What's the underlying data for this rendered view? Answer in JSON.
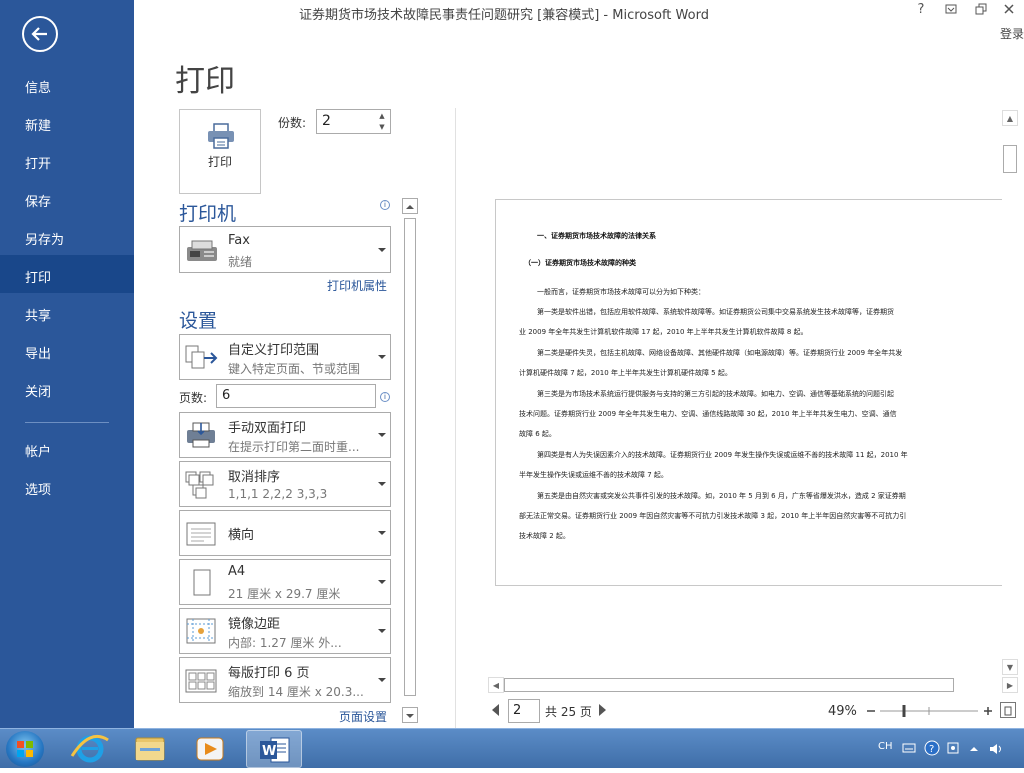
{
  "window": {
    "title": "证券期货市场技术故障民事责任问题研究 [兼容模式] - Microsoft Word",
    "help": "?",
    "login": "登录"
  },
  "sidebar": {
    "items": [
      {
        "label": "信息"
      },
      {
        "label": "新建"
      },
      {
        "label": "打开"
      },
      {
        "label": "保存"
      },
      {
        "label": "另存为"
      },
      {
        "label": "打印",
        "active": true
      },
      {
        "label": "共享"
      },
      {
        "label": "导出"
      },
      {
        "label": "关闭"
      }
    ],
    "bottom": [
      {
        "label": "帐户"
      },
      {
        "label": "选项"
      }
    ],
    "bg_color": "#2b579a",
    "active_color": "#19478a"
  },
  "print": {
    "heading": "打印",
    "print_button": "打印",
    "copies_label": "份数:",
    "copies_value": "2",
    "printer_section": "打印机",
    "printer": {
      "name": "Fax",
      "status": "就绪"
    },
    "printer_properties": "打印机属性",
    "settings_section": "设置",
    "range": {
      "title": "自定义打印范围",
      "sub": "键入特定页面、节或范围"
    },
    "pages_label": "页数:",
    "pages_value": "6",
    "duplex": {
      "title": "手动双面打印",
      "sub": "在提示打印第二面时重..."
    },
    "collate": {
      "title": "取消排序",
      "sub": "1,1,1    2,2,2    3,3,3"
    },
    "orientation": {
      "title": "横向"
    },
    "paper": {
      "title": "A4",
      "sub": "21 厘米 x 29.7 厘米"
    },
    "margins": {
      "title": "镜像边距",
      "sub": "内部:  1.27 厘米     外..."
    },
    "per_sheet": {
      "title": "每版打印 6 页",
      "sub": "缩放到 14 厘米 x 20.3..."
    },
    "page_setup": "页面设置"
  },
  "preview": {
    "current_page": "2",
    "total_pages": "共 25 页",
    "zoom": "49%",
    "zoom_fraction": 0.49,
    "document": {
      "heading1": "一、证券期货市场技术故障的法律关系",
      "heading2": "（一）证券期货市场技术故障的种类",
      "lines": [
        "一般而言，证券期货市场技术故障可以分为如下种类：",
        "第一类是软件出错，包括应用软件故障、系统软件故障等。如证券期货公司集中交易系统发生技术故障等，证券期货",
        "业 2009 年全年共发生计算机软件故障 17 起，2010 年上半年共发生计算机软件故障 8 起。",
        "第二类是硬件失灵，包括主机故障、网络设备故障、其他硬件故障（如电源故障）等。证券期货行业 2009 年全年共发",
        "计算机硬件故障 7 起，2010 年上半年共发生计算机硬件故障 5 起。",
        "第三类是为市场技术系统运行提供服务与支持的第三方引起的技术故障。如电力、空调、通信等基础系统的问题引起",
        "技术问题。证券期货行业 2009 年全年共发生电力、空调、通信线路故障 30 起，2010 年上半年共发生电力、空调、通信",
        "故障 6 起。",
        "第四类是有人为失误因素介入的技术故障。证券期货行业 2009 年发生操作失误或运维不善的技术故障 11 起，2010 年",
        "半年发生操作失误或运维不善的技术故障 7 起。",
        "第五类是由自然灾害或突发公共事件引发的技术故障。如，2010 年 5 月到 6 月，广东等省爆发洪水，造成 2 家证券期",
        "部无法正常交易。证券期货行业 2009 年因自然灾害等不可抗力引发技术故障 3 起，2010 年上半年因自然灾害等不可抗力引",
        "技术故障 2 起。"
      ]
    }
  },
  "taskbar": {
    "apps": [
      {
        "icon": "internet-explorer-icon"
      },
      {
        "icon": "file-explorer-icon"
      },
      {
        "icon": "media-player-icon"
      },
      {
        "icon": "word-icon",
        "active": true
      }
    ],
    "ime": "CH"
  }
}
